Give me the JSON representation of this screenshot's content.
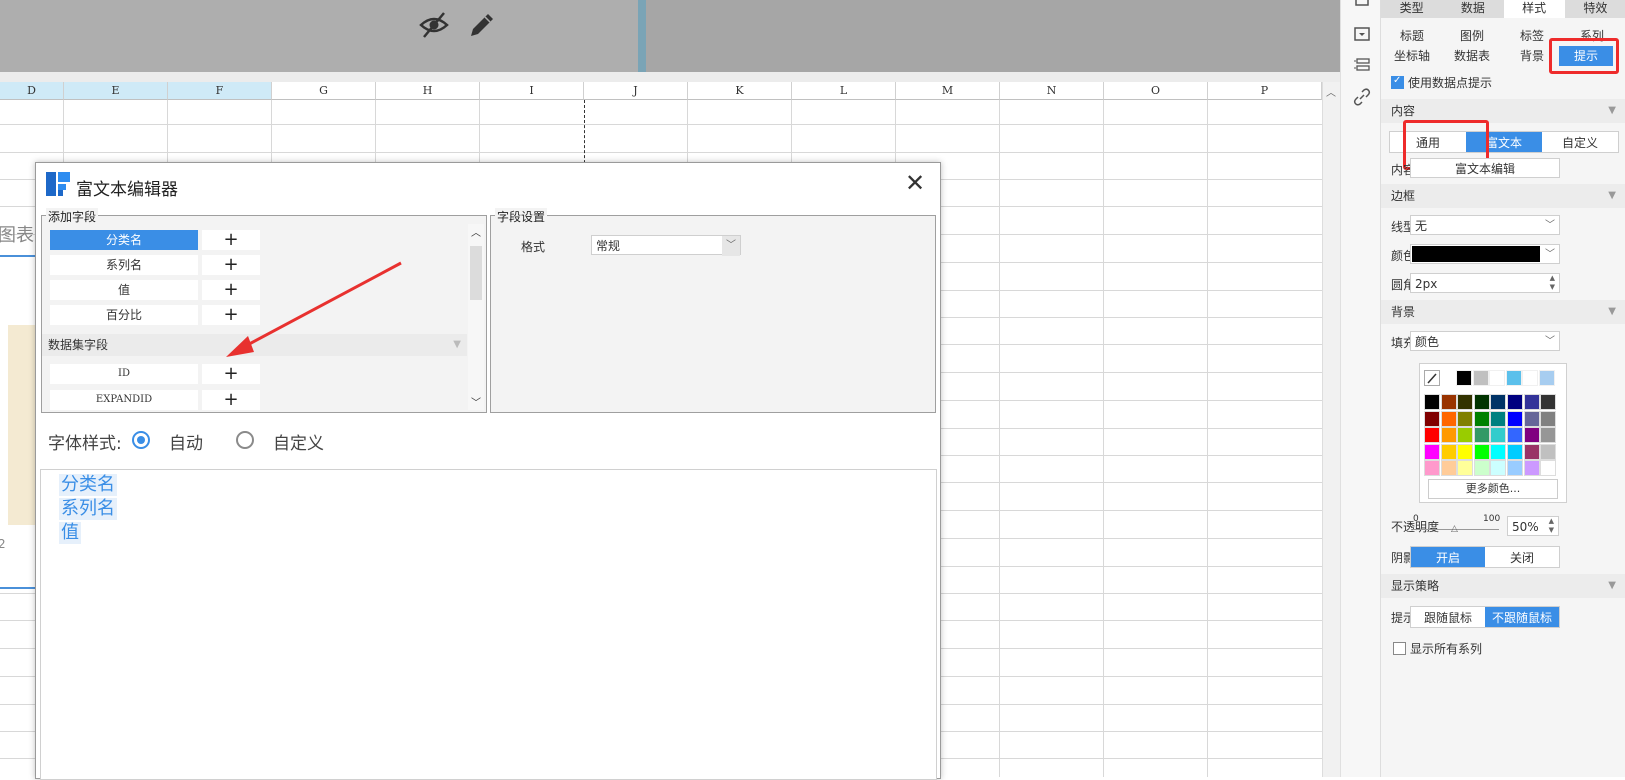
{
  "right_panel": {
    "main_tabs": [
      "类型",
      "数据",
      "样式",
      "特效"
    ],
    "active_main_tab": "样式",
    "sub_tabs_row1": [
      "标题",
      "图例",
      "标签",
      "系列"
    ],
    "sub_tabs_row2": [
      "坐标轴",
      "数据表",
      "背景",
      "提示"
    ],
    "active_sub_tab": "提示",
    "use_datapoint_tooltip": "使用数据点提示",
    "content_section": "内容",
    "content_modes": [
      "通用",
      "富文本",
      "自定义"
    ],
    "active_content_mode": "富文本",
    "content_style_label": "内容样式",
    "rich_text_edit_button": "富文本编辑",
    "border_section": "边框",
    "line_type_label": "线型",
    "line_type_value": "无",
    "color_label": "颜色",
    "color_value_hex": "#000000",
    "radius_label": "圆角",
    "radius_value": "2px",
    "background_section": "背景",
    "fill_label": "填充",
    "fill_value": "颜色",
    "more_colors": "更多颜色...",
    "opacity_label": "不透明度",
    "opacity_min": "0",
    "opacity_max": "100",
    "opacity_value": "50%",
    "shadow_label": "阴影",
    "shadow_options": [
      "开启",
      "关闭"
    ],
    "shadow_active": "开启",
    "display_strategy_section": "显示策略",
    "tooltip_box_label": "提示框",
    "tooltip_box_options": [
      "跟随鼠标",
      "不跟随鼠标"
    ],
    "tooltip_box_active": "不跟随鼠标",
    "show_all_series": "显示所有系列"
  },
  "sheet": {
    "columns": [
      "D",
      "E",
      "F",
      "G",
      "H",
      "I",
      "J",
      "K",
      "L",
      "M",
      "N",
      "O",
      "P"
    ],
    "selected_columns": [
      "D",
      "E",
      "F"
    ],
    "chart_fragment_title": "图表",
    "chart_fragment_axis": "2"
  },
  "dialog": {
    "title": "富文本编辑器",
    "add_field_group": "添加字段",
    "field_settings_group": "字段设置",
    "fields": [
      "分类名",
      "系列名",
      "值",
      "百分比"
    ],
    "selected_field": "分类名",
    "dataset_fields_header": "数据集字段",
    "dataset_fields": [
      "ID",
      "EXPANDID"
    ],
    "plus_label": "+",
    "format_label": "格式",
    "format_value": "常规",
    "font_style_label": "字体样式:",
    "font_style_options": [
      "自动",
      "自定义"
    ],
    "font_style_selected": "自动",
    "editor_content": [
      "分类名",
      "系列名",
      "值"
    ]
  },
  "palette_colors": [
    [
      "#000000",
      "#993300",
      "#333300",
      "#003300",
      "#003366",
      "#000080",
      "#333399",
      "#333333"
    ],
    [
      "#800000",
      "#FF6600",
      "#808000",
      "#008000",
      "#008080",
      "#0000FF",
      "#666699",
      "#808080"
    ],
    [
      "#FF0000",
      "#FF9900",
      "#99CC00",
      "#339966",
      "#33CCCC",
      "#3366FF",
      "#800080",
      "#969696"
    ],
    [
      "#FF00FF",
      "#FFCC00",
      "#FFFF00",
      "#00FF00",
      "#00FFFF",
      "#00CCFF",
      "#993366",
      "#C0C0C0"
    ],
    [
      "#FF99CC",
      "#FFCC99",
      "#FFFF99",
      "#CCFFCC",
      "#CCFFFF",
      "#99CCFF",
      "#CC99FF",
      "#FFFFFF"
    ]
  ],
  "palette_recent": [
    "#000000",
    "#C0C0C0",
    "#FFFFFF",
    "#5BC0EB",
    "#FFFFFF",
    "#A7CDF0"
  ],
  "accent_color": "#3A8EE6"
}
